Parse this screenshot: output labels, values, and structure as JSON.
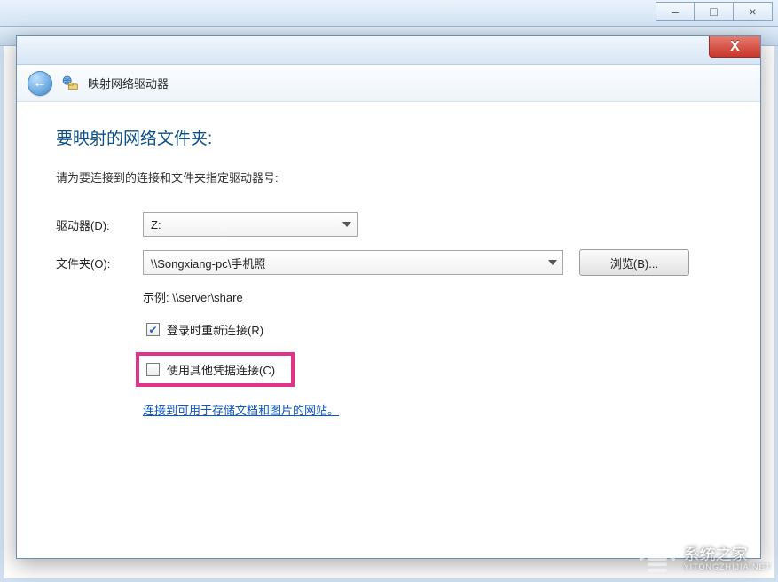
{
  "parent": {
    "min_tip": "–",
    "max_tip": "□",
    "close_tip": "×"
  },
  "dialog": {
    "title": "映射网络驱动器",
    "close": "X",
    "heading": "要映射的网络文件夹:",
    "instruction": "请为要连接到的连接和文件夹指定驱动器号:",
    "drive_label": "驱动器(D):",
    "drive_value": "Z:",
    "folder_label": "文件夹(O):",
    "folder_value": "\\\\Songxiang-pc\\手机照",
    "browse": "浏览(B)...",
    "example": "示例: \\\\server\\share",
    "reconnect": "登录时重新连接(R)",
    "othercred": "使用其他凭据连接(C)",
    "link": "连接到可用于存储文档和图片的网站"
  },
  "watermark": {
    "main": "系统之家",
    "sub": "YITONGZHIJIA.NET"
  }
}
